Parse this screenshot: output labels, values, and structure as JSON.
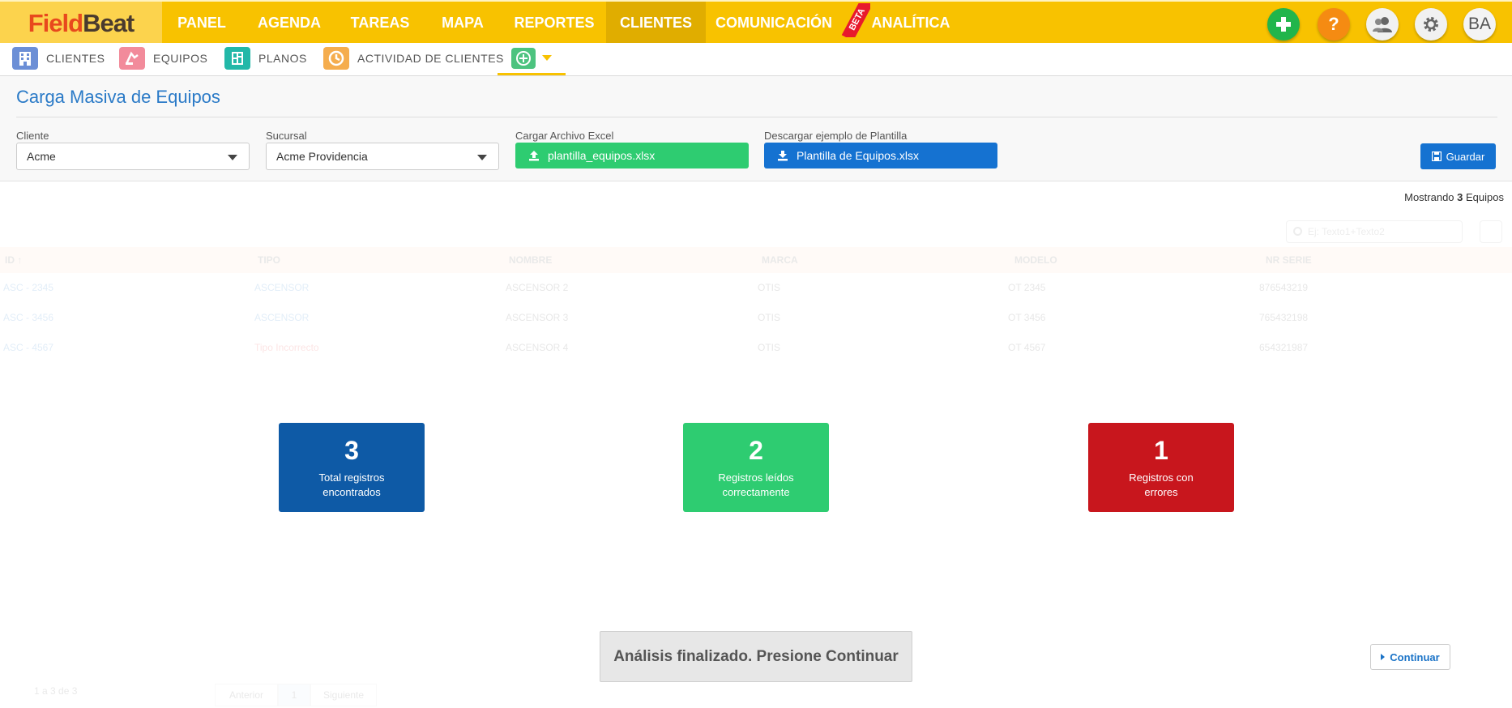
{
  "brand": {
    "part1": "Field",
    "part2": "Beat"
  },
  "nav": {
    "items": [
      {
        "label": "PANEL"
      },
      {
        "label": "AGENDA"
      },
      {
        "label": "TAREAS"
      },
      {
        "label": "MAPA"
      },
      {
        "label": "REPORTES"
      },
      {
        "label": "CLIENTES",
        "active": true
      },
      {
        "label": "COMUNICACIÓN"
      },
      {
        "label": "ANALÍTICA"
      }
    ],
    "beta_badge": "BETA",
    "help_glyph": "?",
    "avatar_initials": "BA",
    "accent_color": "#f8c200"
  },
  "subnav": {
    "items": [
      {
        "label": "CLIENTES",
        "icon": "building-icon",
        "color": "#6c8fd6"
      },
      {
        "label": "EQUIPOS",
        "icon": "equipment-icon",
        "color": "#f28b9b"
      },
      {
        "label": "PLANOS",
        "icon": "blueprint-icon",
        "color": "#22b8a8"
      },
      {
        "label": "ACTIVIDAD DE CLIENTES",
        "icon": "clock-icon",
        "color": "#f5ad4e"
      }
    ]
  },
  "page": {
    "title": "Carga Masiva de Equipos",
    "cliente_label": "Cliente",
    "cliente_value": "Acme",
    "sucursal_label": "Sucursal",
    "sucursal_value": "Acme Providencia",
    "upload_label": "Cargar Archivo Excel",
    "upload_file": "plantilla_equipos.xlsx",
    "download_label": "Descargar ejemplo de Plantilla",
    "download_file": "Plantilla de Equipos.xlsx",
    "save_label": "Guardar",
    "showing_prefix": "Mostrando",
    "showing_count": "3",
    "showing_suffix": "Equipos"
  },
  "table": {
    "search_placeholder": "Ej: Texto1+Texto2",
    "columns": [
      "ID ↑",
      "TIPO",
      "NOMBRE",
      "MARCA",
      "MODELO",
      "NR SERIE"
    ],
    "rows": [
      {
        "id": "ASC - 2345",
        "tipo": "ASCENSOR",
        "nombre": "ASCENSOR 2",
        "marca": "OTIS",
        "modelo": "OT 2345",
        "serie": "876543219"
      },
      {
        "id": "ASC - 3456",
        "tipo": "ASCENSOR",
        "nombre": "ASCENSOR 3",
        "marca": "OTIS",
        "modelo": "OT 3456",
        "serie": "765432198"
      },
      {
        "id": "ASC - 4567",
        "tipo": "Tipo Incorrecto",
        "nombre": "ASCENSOR 4",
        "marca": "OTIS",
        "modelo": "OT 4567",
        "serie": "654321987"
      }
    ],
    "pager_info": "1 a 3 de 3",
    "prev_label": "Anterior",
    "page_number": "1",
    "next_label": "Siguiente"
  },
  "stats": [
    {
      "value": "3",
      "caption": "Total registros encontrados",
      "color": "#0e5aa6"
    },
    {
      "value": "2",
      "caption": "Registros leídos correctamente",
      "color": "#2ecc71"
    },
    {
      "value": "1",
      "caption": "Registros con errores",
      "color": "#c8161d"
    }
  ],
  "footer": {
    "message": "Análisis finalizado. Presione Continuar",
    "continue_label": "Continuar"
  }
}
